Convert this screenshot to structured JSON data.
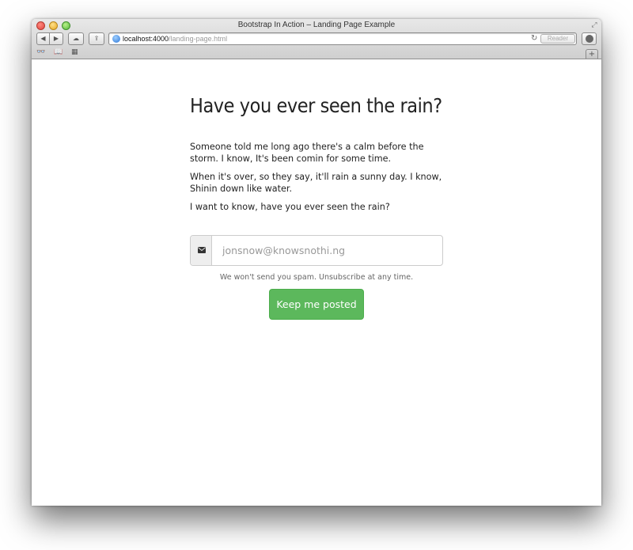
{
  "window": {
    "title": "Bootstrap In Action – Landing Page Example"
  },
  "toolbar": {
    "back_icon": "◀",
    "forward_icon": "▶",
    "cloud_icon": "☁",
    "share_icon": "⇪",
    "url_host": "localhost:4000",
    "url_path": "/landing-page.html",
    "reload_icon": "↻",
    "reader_label": "Reader"
  },
  "bookmarks": {
    "reading_list_icon": "👓",
    "bookmarks_icon": "📖",
    "top_sites_icon": "▦",
    "new_tab_icon": "+"
  },
  "page": {
    "headline": "Have you ever seen the rain?",
    "paragraphs": [
      "Someone told me long ago there's a calm before the storm. I know, It's been comin for some time.",
      "When it's over, so they say, it'll rain a sunny day. I know, Shinin down like water.",
      "I want to know, have you ever seen the rain?"
    ],
    "email_placeholder": "jonsnow@knowsnothi.ng",
    "help_text": "We won't send you spam. Unsubscribe at any time.",
    "cta_label": "Keep me posted"
  },
  "colors": {
    "cta_green": "#5cb85c",
    "addon_gray": "#eeeeee",
    "text_dark": "#222222"
  }
}
